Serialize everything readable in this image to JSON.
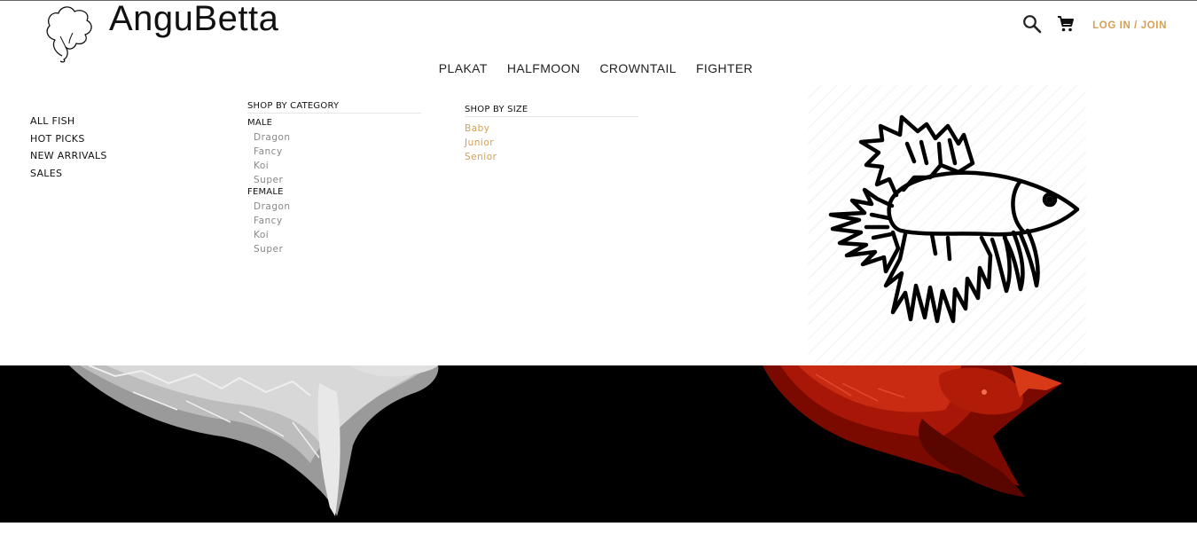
{
  "header": {
    "brand": "AnguBetta",
    "logo_icon": "tree-head-icon",
    "search_icon": "search-icon",
    "cart_icon": "cart-icon",
    "login_label": "LOG IN / JOIN"
  },
  "nav": {
    "items": [
      {
        "label": "PLAKAT"
      },
      {
        "label": "HALFMOON"
      },
      {
        "label": "CROWNTAIL"
      },
      {
        "label": "FIGHTER"
      }
    ]
  },
  "mega_menu": {
    "quick_links": [
      {
        "label": "ALL FISH"
      },
      {
        "label": "HOT PICKS"
      },
      {
        "label": "NEW ARRIVALS"
      },
      {
        "label": "SALES"
      }
    ],
    "category": {
      "heading": "SHOP BY CATEGORY",
      "groups": [
        {
          "label": "MALE",
          "items": [
            "Dragon",
            "Fancy",
            "Koi",
            "Super"
          ]
        },
        {
          "label": "FEMALE",
          "items": [
            "Dragon",
            "Fancy",
            "Koi",
            "Super"
          ]
        }
      ]
    },
    "size": {
      "heading": "SHOP BY SIZE",
      "items": [
        "Baby",
        "Junior",
        "Senior"
      ]
    },
    "promo_icon": "betta-fish-icon"
  },
  "banner": {
    "left_image": "white-betta-fins",
    "right_image": "red-betta-fish"
  },
  "colors": {
    "accent": "#d4a055",
    "text": "#111111",
    "muted": "#888888",
    "banner_bg": "#000000"
  }
}
